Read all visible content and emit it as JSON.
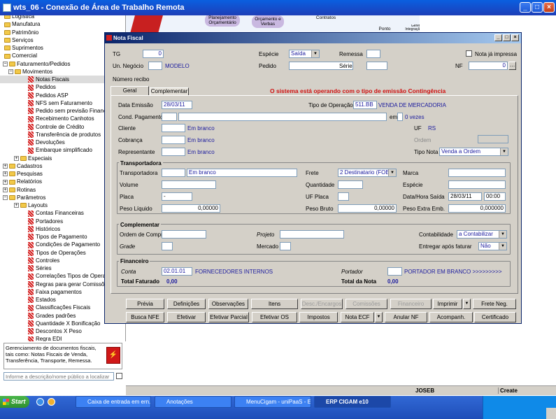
{
  "rdp": {
    "title": "wts_06 - Conexão de Área de Trabalho Remota"
  },
  "tree": [
    {
      "label": "Logística",
      "type": "folder",
      "x": 6
    },
    {
      "label": "Manufatura",
      "type": "folder",
      "x": 6
    },
    {
      "label": "Patrimônio",
      "type": "folder",
      "x": 6
    },
    {
      "label": "Serviços",
      "type": "folder",
      "x": 6
    },
    {
      "label": "Suprimentos",
      "type": "folder",
      "x": 6
    },
    {
      "label": "Comercial",
      "type": "folder",
      "x": 6
    },
    {
      "label": "Faturamento/Pedidos",
      "type": "folder",
      "x": 14,
      "exp": "−"
    },
    {
      "label": "Movimentos",
      "type": "folder",
      "x": 22,
      "exp": "−"
    },
    {
      "label": "Notas Fiscais",
      "type": "item",
      "x": 40,
      "selected": true
    },
    {
      "label": "Pedidos",
      "type": "item",
      "x": 40
    },
    {
      "label": "Pedidos ASP",
      "type": "item",
      "x": 40
    },
    {
      "label": "NFS sem Faturamento",
      "type": "item",
      "x": 40
    },
    {
      "label": "Pedido sem previsão Finance",
      "type": "item",
      "x": 40
    },
    {
      "label": "Recebimento Canhotos",
      "type": "item",
      "x": 40
    },
    {
      "label": "Controle de Crédito",
      "type": "item",
      "x": 40
    },
    {
      "label": "Transferência de produtos",
      "type": "item",
      "x": 40
    },
    {
      "label": "Devoluções",
      "type": "item",
      "x": 40
    },
    {
      "label": "Embarque simplificado",
      "type": "item",
      "x": 40
    },
    {
      "label": "Especiais",
      "type": "folder",
      "x": 30,
      "exp": "+"
    },
    {
      "label": "Cadastros",
      "type": "folder",
      "x": 14,
      "exp": "+"
    },
    {
      "label": "Pesquisas",
      "type": "folder",
      "x": 14,
      "exp": "+"
    },
    {
      "label": "Relatórios",
      "type": "folder",
      "x": 14,
      "exp": "+"
    },
    {
      "label": "Rotinas",
      "type": "folder",
      "x": 14,
      "exp": "+"
    },
    {
      "label": "Parâmetros",
      "type": "folder",
      "x": 14,
      "exp": "−"
    },
    {
      "label": "Layouts",
      "type": "folder",
      "x": 30,
      "exp": "+"
    },
    {
      "label": "Contas Financeiras",
      "type": "item",
      "x": 40
    },
    {
      "label": "Portadores",
      "type": "item",
      "x": 40
    },
    {
      "label": "Históricos",
      "type": "item",
      "x": 40
    },
    {
      "label": "Tipos de Pagamento",
      "type": "item",
      "x": 40
    },
    {
      "label": "Condições de Pagamento",
      "type": "item",
      "x": 40
    },
    {
      "label": "Tipos de Operações",
      "type": "item",
      "x": 40
    },
    {
      "label": "Controles",
      "type": "item",
      "x": 40
    },
    {
      "label": "Séries",
      "type": "item",
      "x": 40
    },
    {
      "label": "Correlações Tipos de Operaç",
      "type": "item",
      "x": 40
    },
    {
      "label": "Regras para gerar Comissõe",
      "type": "item",
      "x": 40
    },
    {
      "label": "Faixa pagamentos",
      "type": "item",
      "x": 40
    },
    {
      "label": "Estados",
      "type": "item",
      "x": 40
    },
    {
      "label": "Classificações Fiscais",
      "type": "item",
      "x": 40
    },
    {
      "label": "Grades padrões",
      "type": "item",
      "x": 40
    },
    {
      "label": "Quantidade X Bonificação",
      "type": "item",
      "x": 40
    },
    {
      "label": "Descontos X Peso",
      "type": "item",
      "x": 40
    },
    {
      "label": "Regra EDI",
      "type": "item",
      "x": 40
    }
  ],
  "help_text": "Gerenciamento de documentos fiscais, tais como: Notas Fiscais de Venda, Transferência, Transporte, Remessa.",
  "search": {
    "placeholder": "Informe a descrição/nome público a localizar"
  },
  "bg_diagram": {
    "planejamento": "Planejamento Orçamentário",
    "orcamento": "Orçamento e Verbas",
    "contratos": "Contratos",
    "ponto": "Ponto",
    "gerenciamento": "Gerenciamento e Integração de Processos"
  },
  "nf": {
    "title": "Nota Fiscal",
    "tg_label": "TG",
    "tg_value": "0",
    "especie_label": "Espécie",
    "especie_value": "Saída",
    "remessa_label": "Remessa",
    "nota_impressa_label": "Nota já impressa",
    "un_negocio_label": "Un. Negócio",
    "un_negocio_value": "MODELO",
    "pedido_label": "Pedido",
    "serie_label": "Série",
    "nf_label": "NF",
    "nf_value": "0",
    "numero_recibo_label": "Número recibo",
    "tab_geral": "Geral",
    "tab_complementar": "Complementar",
    "contingencia_msg": "O sistema está operando com o tipo de emissão Contingência",
    "data_emissao_label": "Data Emissão",
    "data_emissao_value": "28/03/11",
    "tipo_operacao_label": "Tipo de Operação",
    "tipo_operacao_code": "511.BB",
    "tipo_operacao_desc": "VENDA DE MERCADORIA",
    "cond_pagamento_label": "Cond. Pagamento",
    "em_label": "em",
    "vezes_value": "0 vezes",
    "cliente_label": "Cliente",
    "cliente_value": "Em branco",
    "uf_label": "UF",
    "uf_value": "RS",
    "cobranca_label": "Cobrança",
    "cobranca_value": "Em branco",
    "ordem_label": "Ordem",
    "representante_label": "Representante",
    "representante_value": "Em branco",
    "tipo_nota_label": "Tipo Nota",
    "tipo_nota_value": "Venda a Ordem",
    "transportadora_section": "Transportadora",
    "transportadora_label": "Transportadora",
    "transportadora_value": "Em branco",
    "frete_label": "Frete",
    "frete_value": "2 Destinatario (FOB)",
    "marca_label": "Marca",
    "volume_label": "Volume",
    "quantidade_label": "Quantidade",
    "especie2_label": "Espécie",
    "placa_label": "Placa",
    "placa_value": "-",
    "uf_placa_label": "UF Placa",
    "data_hora_saida_label": "Data/Hora Saída",
    "data_saida_value": "28/03/11",
    "hora_saida_value": "00:00",
    "peso_liquido_label": "Peso Líquido",
    "peso_liquido_value": "0,00000",
    "peso_bruto_label": "Peso Bruto",
    "peso_bruto_value": "0,00000",
    "peso_extra_label": "Peso Extra Emb.",
    "peso_extra_value": "0,000000",
    "complementar_section": "Complementar",
    "ordem_compra_label": "Ordem de Compra",
    "projeto_label": "Projeto",
    "contabilidade_label": "Contabilidade",
    "contabilidade_value": "a Contabilizar",
    "grade_label": "Grade",
    "mercado_label": "Mercado",
    "entregar_label": "Entregar após faturar",
    "entregar_value": "Não",
    "financeiro_section": "Financeiro",
    "conta_label": "Conta",
    "conta_code": "02.01.01",
    "conta_desc": "FORNECEDORES INTERNOS",
    "portador_label": "Portador",
    "portador_desc": "PORTADOR EM BRANCO >>>>>>>>>",
    "total_faturado_label": "Total Faturado",
    "total_faturado_value": "0,00",
    "total_nota_label": "Total da Nota",
    "total_nota_value": "0,00"
  },
  "buttons_row1": [
    {
      "label": "Prévia",
      "enabled": true
    },
    {
      "label": "Definições",
      "enabled": true
    },
    {
      "label": "Observações",
      "enabled": true
    },
    {
      "label": "Itens",
      "enabled": true
    },
    {
      "label": "Desc./Encargos",
      "enabled": false
    },
    {
      "label": "Comissões",
      "enabled": false
    },
    {
      "label": "Financeiro",
      "enabled": false
    },
    {
      "label": "Imprimir",
      "enabled": true
    },
    {
      "label": "Frete Neg.",
      "enabled": true
    }
  ],
  "buttons_row2": [
    {
      "label": "Busca NFE",
      "enabled": true
    },
    {
      "label": "Efetivar",
      "enabled": true
    },
    {
      "label": "Efetivar Parcial",
      "enabled": true
    },
    {
      "label": "Efetivar OS",
      "enabled": true
    },
    {
      "label": "Impostos",
      "enabled": true
    },
    {
      "label": "Nota ECF",
      "enabled": true
    },
    {
      "label": "Anular NF",
      "enabled": true
    },
    {
      "label": "Acompanh.",
      "enabled": true
    },
    {
      "label": "Certificado",
      "enabled": true
    }
  ],
  "statusbar": {
    "user": "JOSEB",
    "mode": "Create"
  },
  "taskbar": {
    "start": "Start",
    "tasks": [
      "Caixa de entrada em ern...",
      "Anotações",
      "MenuCigam - uniPaaS - E...",
      "ERP CIGAM e10"
    ]
  },
  "colors": {
    "contingencia": "#d01010",
    "blue_text": "#1a1a9e"
  }
}
